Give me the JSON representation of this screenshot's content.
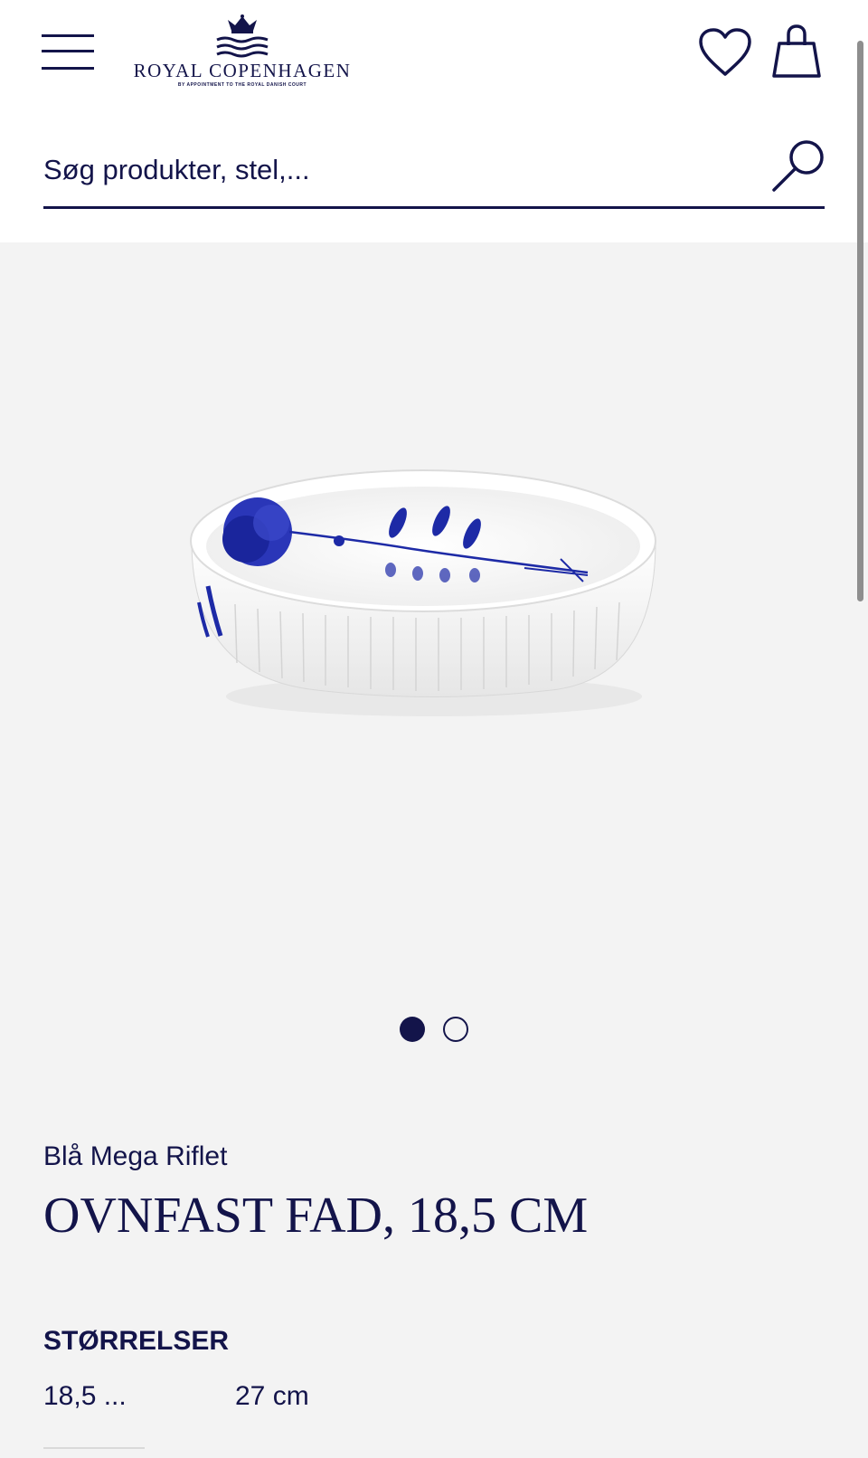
{
  "brand": {
    "name": "ROYAL COPENHAGEN",
    "tagline": "BY APPOINTMENT TO THE ROYAL DANISH COURT"
  },
  "header": {
    "menu_icon": "hamburger-menu-icon",
    "wishlist_icon": "heart-icon",
    "cart_icon": "shopping-bag-icon"
  },
  "search": {
    "placeholder": "Søg produkter, stel,...",
    "icon": "search-icon"
  },
  "gallery": {
    "slide_count": 2,
    "active_slide": 1
  },
  "product": {
    "collection": "Blå Mega Riflet",
    "title": "OVNFAST FAD, 18,5 CM"
  },
  "sizes": {
    "heading": "STØRRELSER",
    "options": [
      "18,5 ...",
      "27 cm"
    ],
    "selected_index": 0
  },
  "colors": {
    "brand_navy": "#13144a",
    "background": "#f3f3f3",
    "porcelain_blue": "#1d2aa6"
  }
}
